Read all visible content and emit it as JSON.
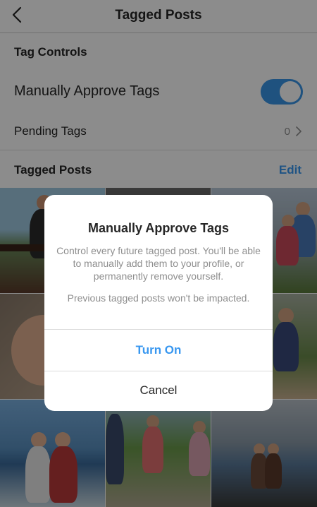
{
  "header": {
    "title": "Tagged Posts",
    "back_icon": "chevron-left-icon"
  },
  "tag_controls": {
    "section_title": "Tag Controls"
  },
  "manual_approve": {
    "label": "Manually Approve Tags",
    "enabled": true,
    "toggle_color": "#3a96e8"
  },
  "pending": {
    "label": "Pending Tags",
    "count": "0",
    "chevron_icon": "chevron-right-icon"
  },
  "tagged_posts": {
    "section_title": "Tagged Posts",
    "edit_label": "Edit"
  },
  "dialog": {
    "title": "Manually Approve Tags",
    "body": "Control every future tagged post. You'll be able to manually add them to your profile, or permanently remove yourself.",
    "note": "Previous tagged posts won't be impacted.",
    "primary_button": "Turn On",
    "secondary_button": "Cancel"
  },
  "colors": {
    "accent": "#3897f0",
    "text": "#262626",
    "secondary_text": "#8e8e8e"
  }
}
